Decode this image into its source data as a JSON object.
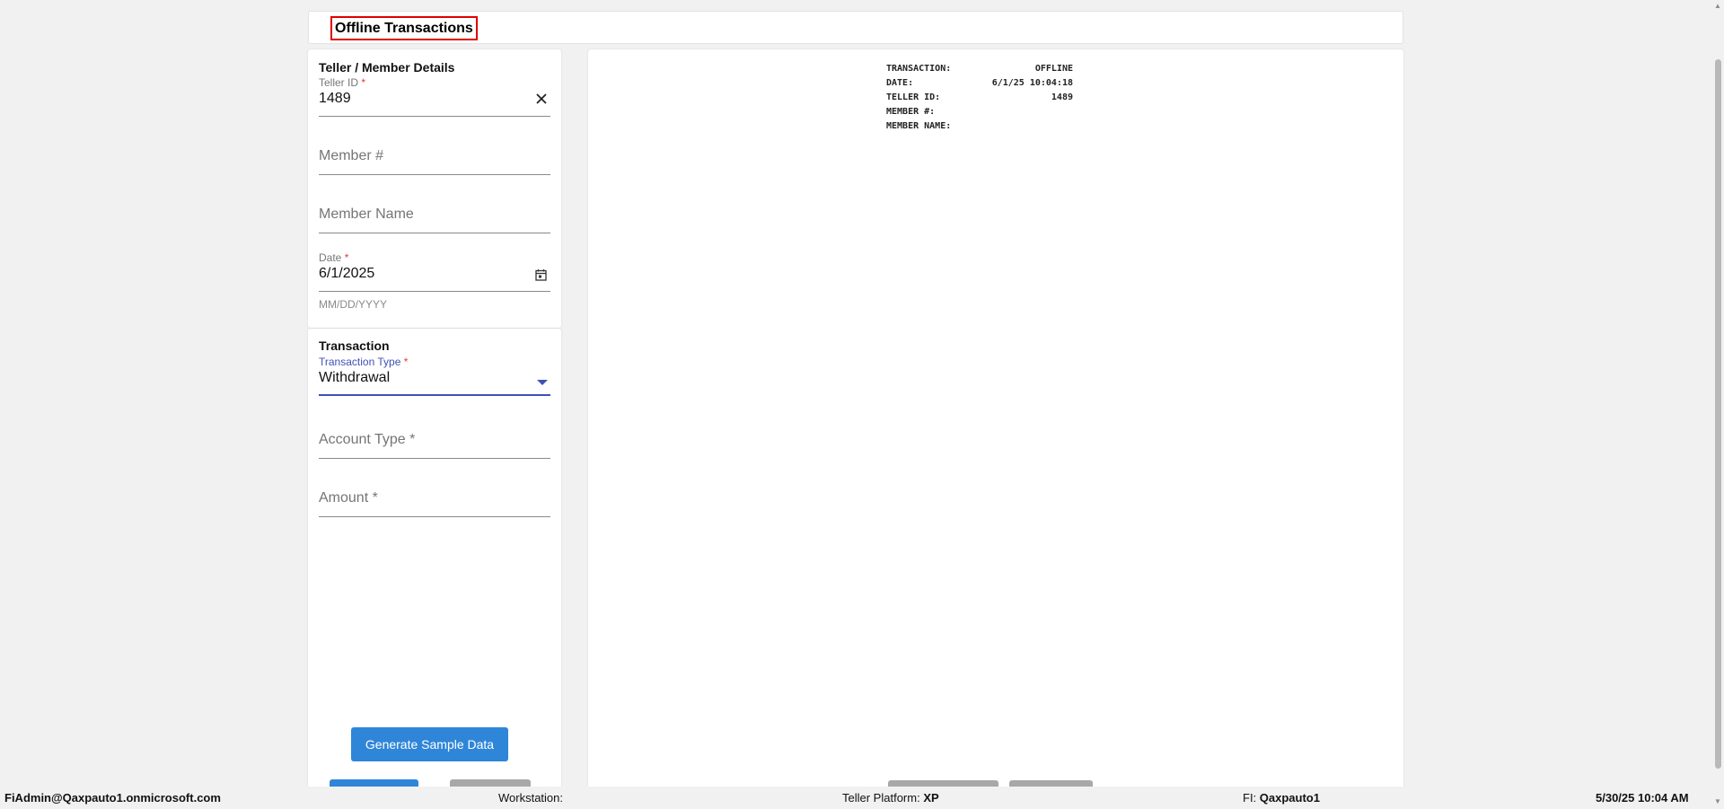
{
  "header": {
    "title": "Offline Transactions"
  },
  "teller_section": {
    "title": "Teller / Member Details",
    "teller_id": {
      "label": "Teller ID",
      "required_mark": "*",
      "value": "1489"
    },
    "member_number": {
      "placeholder": "Member #"
    },
    "member_name": {
      "placeholder": "Member Name"
    },
    "date": {
      "label": "Date",
      "required_mark": "*",
      "value": "6/1/2025",
      "hint": "MM/DD/YYYY"
    }
  },
  "transaction_section": {
    "title": "Transaction",
    "transaction_type": {
      "label": "Transaction Type",
      "required_mark": "*",
      "value": "Withdrawal"
    },
    "account_type": {
      "placeholder": "Account Type *"
    },
    "amount": {
      "placeholder": "Amount *"
    },
    "generate_button": "Generate Sample Data"
  },
  "receipt": {
    "rows": [
      {
        "key": "TRANSACTION:",
        "value": "OFFLINE"
      },
      {
        "key": "DATE:",
        "value": "6/1/25 10:04:18"
      },
      {
        "key": "TELLER ID:",
        "value": "1489"
      },
      {
        "key": "MEMBER #:",
        "value": ""
      },
      {
        "key": "MEMBER NAME:",
        "value": ""
      }
    ]
  },
  "status_bar": {
    "user": "FiAdmin@Qaxpauto1.onmicrosoft.com",
    "workstation_label": "Workstation:",
    "workstation_value": "",
    "platform_label": "Teller Platform:",
    "platform_value": "XP",
    "fi_label": "FI:",
    "fi_value": "Qaxpauto1",
    "datetime": "5/30/25 10:04 AM"
  },
  "icons": {
    "clear": "close-icon",
    "calendar": "calendar-icon",
    "dropdown": "caret-down-icon"
  },
  "colors": {
    "accent": "#3f51b5",
    "button_primary": "#2f86d8",
    "required": "#e53935",
    "highlight_border": "#e00000"
  }
}
